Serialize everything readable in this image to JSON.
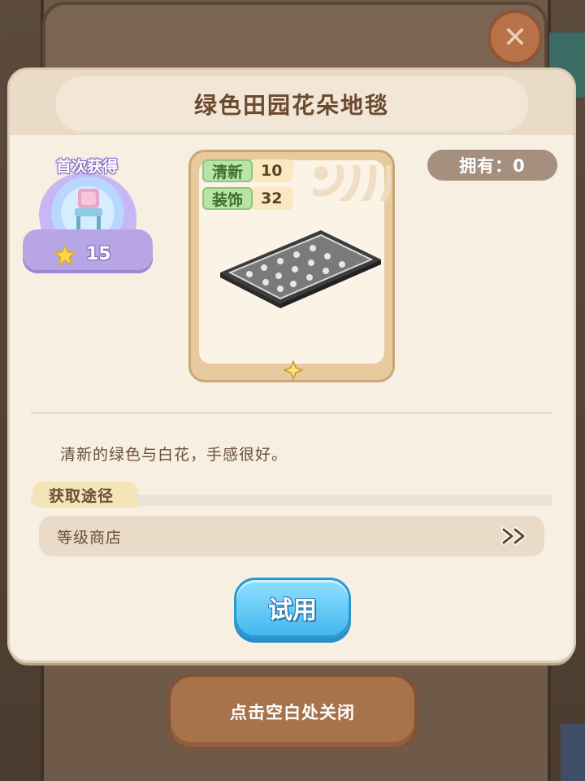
{
  "dialog": {
    "title": "绿色田园花朵地毯",
    "first_obtain": {
      "label": "首次获得",
      "reward_count": "15"
    },
    "item": {
      "stats": [
        {
          "name": "清新",
          "value": "10"
        },
        {
          "name": "装饰",
          "value": "32"
        }
      ]
    },
    "owned": "拥有：0",
    "description": "清新的绿色与白花，手感很好。",
    "source": {
      "label": "获取途径",
      "entry": "等级商店"
    },
    "try_button": "试用"
  },
  "close_hint": "点击空白处关闭",
  "colors": {
    "try_button": "#44b8ef",
    "badge": "#c7b8f5",
    "stat_tag": "#b9e3a7"
  }
}
